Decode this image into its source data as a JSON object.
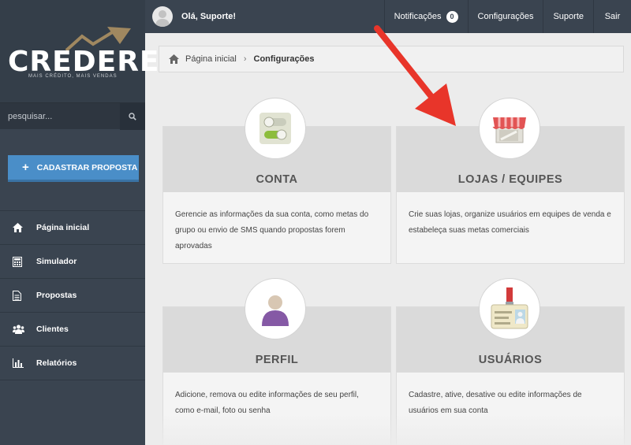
{
  "brand": {
    "name": "CREDERE",
    "tagline": "MAIS CRÉDITO, MAIS VENDAS"
  },
  "search": {
    "placeholder": "pesquisar..."
  },
  "sidebar": {
    "add_button": "CADASTRAR PROPOSTA",
    "items": [
      {
        "label": "Página inicial",
        "icon": "home-icon"
      },
      {
        "label": "Simulador",
        "icon": "calculator-icon"
      },
      {
        "label": "Propostas",
        "icon": "document-icon"
      },
      {
        "label": "Clientes",
        "icon": "users-icon"
      },
      {
        "label": "Relatórios",
        "icon": "bar-chart-icon"
      }
    ]
  },
  "topbar": {
    "greeting": "Olá, Suporte!",
    "notifications_label": "Notificações",
    "notifications_count": "0",
    "settings": "Configurações",
    "support": "Suporte",
    "logout": "Sair"
  },
  "breadcrumb": {
    "home": "Página inicial",
    "current": "Configurações"
  },
  "cards": [
    {
      "title": "CONTA",
      "icon": "toggle-switches-icon",
      "description": "Gerencie as informações da sua conta, como metas do grupo ou envio de SMS quando propostas forem aprovadas"
    },
    {
      "title": "LOJAS / EQUIPES",
      "icon": "store-icon",
      "description": "Crie suas lojas, organize usuários em equipes de venda e estabeleça suas metas comerciais"
    },
    {
      "title": "PERFIL",
      "icon": "person-icon",
      "description": "Adicione, remova ou edite informações de seu perfil, como e-mail, foto ou senha"
    },
    {
      "title": "USUÁRIOS",
      "icon": "id-badge-icon",
      "description": "Cadastre, ative, desative ou edite informações de usuários em sua conta"
    }
  ],
  "colors": {
    "sidebar": "#3a4450",
    "accent": "#4a8ec8",
    "annotation_arrow": "#e8352a",
    "card_header": "#dadada"
  }
}
